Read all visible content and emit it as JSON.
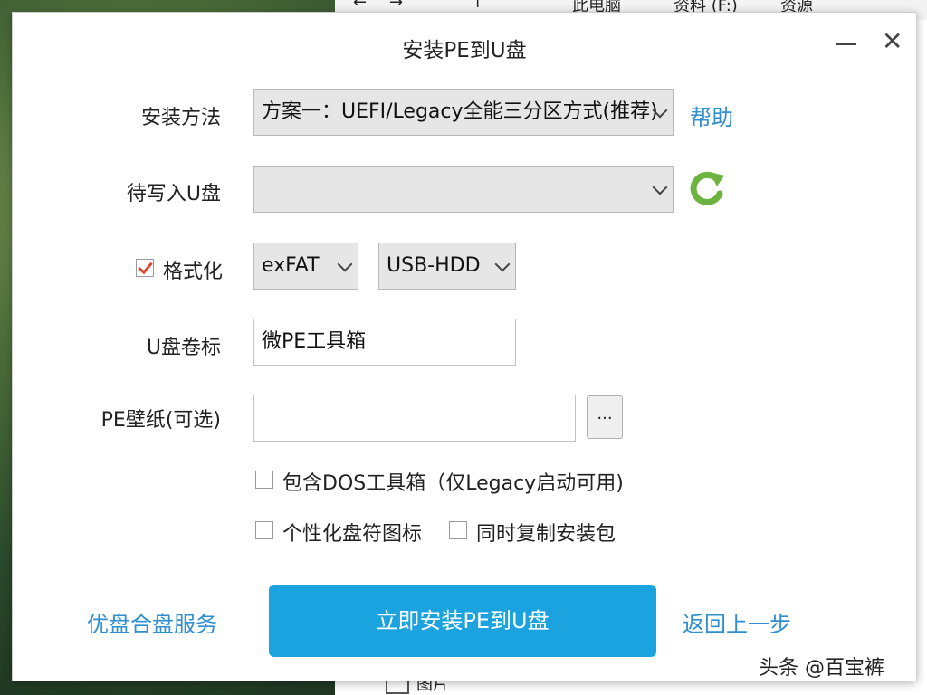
{
  "background": {
    "explorer_breadcrumb": [
      "此电脑",
      "资料 (F:)",
      "资源"
    ],
    "explorer_bottom_item": "图片"
  },
  "dialog": {
    "title": "安装PE到U盘",
    "install_method": {
      "label": "安装方法",
      "value": "方案一：UEFI/Legacy全能三分区方式(推荐)",
      "help_link": "帮助"
    },
    "target_disk": {
      "label": "待写入U盘",
      "value": ""
    },
    "format": {
      "label": "格式化",
      "checked": true,
      "filesystem": "exFAT",
      "mode": "USB-HDD"
    },
    "volume_label": {
      "label": "U盘卷标",
      "value": "微PE工具箱"
    },
    "wallpaper": {
      "label": "PE壁纸(可选)",
      "value": "",
      "browse_label": "..."
    },
    "options": [
      {
        "label": "包含DOS工具箱（仅Legacy启动可用)",
        "checked": false
      },
      {
        "label": "个性化盘符图标",
        "checked": false
      },
      {
        "label": "同时复制安装包",
        "checked": false
      }
    ],
    "footer": {
      "left_link": "优盘合盘服务",
      "install_button": "立即安装PE到U盘",
      "back_link": "返回上一步"
    }
  },
  "watermark": "头条 @百宝裤",
  "colors": {
    "accent": "#1aa3df",
    "link": "#2f8fd0",
    "check": "#e0482e",
    "refresh": "#6cb43f"
  }
}
